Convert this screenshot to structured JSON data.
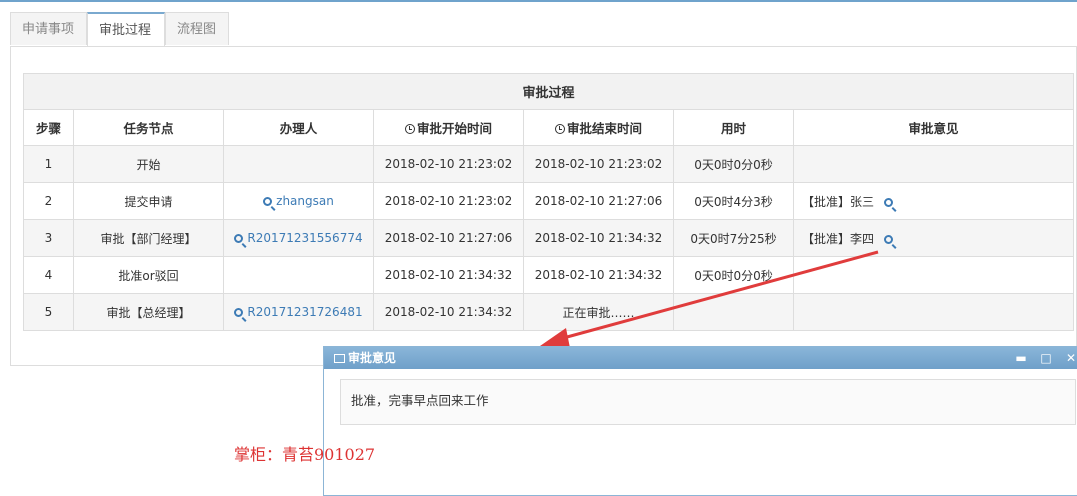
{
  "tabs": [
    {
      "label": "申请事项",
      "active": false
    },
    {
      "label": "审批过程",
      "active": true
    },
    {
      "label": "流程图",
      "active": false
    }
  ],
  "table": {
    "caption": "审批过程",
    "headers": {
      "step": "步骤",
      "node": "任务节点",
      "handler": "办理人",
      "start": "审批开始时间",
      "end": "审批结束时间",
      "duration": "用时",
      "opinion": "审批意见"
    },
    "rows": [
      {
        "step": "1",
        "node": "开始",
        "handler": "",
        "start": "2018-02-10 21:23:02",
        "end": "2018-02-10 21:23:02",
        "duration": "0天0时0分0秒",
        "opinion": ""
      },
      {
        "step": "2",
        "node": "提交申请",
        "handler": "zhangsan",
        "start": "2018-02-10 21:23:02",
        "end": "2018-02-10 21:27:06",
        "duration": "0天0时4分3秒",
        "opinion": "【批准】张三"
      },
      {
        "step": "3",
        "node": "审批【部门经理】",
        "handler": "R20171231556774",
        "start": "2018-02-10 21:27:06",
        "end": "2018-02-10 21:34:32",
        "duration": "0天0时7分25秒",
        "opinion": "【批准】李四"
      },
      {
        "step": "4",
        "node": "批准or驳回",
        "handler": "",
        "start": "2018-02-10 21:34:32",
        "end": "2018-02-10 21:34:32",
        "duration": "0天0时0分0秒",
        "opinion": ""
      },
      {
        "step": "5",
        "node": "审批【总经理】",
        "handler": "R20171231726481",
        "start": "2018-02-10 21:34:32",
        "end": "正在审批……",
        "duration": "",
        "opinion": ""
      }
    ]
  },
  "dialog": {
    "title": "审批意见",
    "content": "批准，完事早点回来工作",
    "minimize": "▬",
    "maximize": "□",
    "close": "✕"
  },
  "watermark": "掌柜：青苔901027",
  "colors": {
    "accent": "#3d7bb5",
    "arrow": "#e03c3c",
    "dialog_title": "#7aaad2"
  }
}
